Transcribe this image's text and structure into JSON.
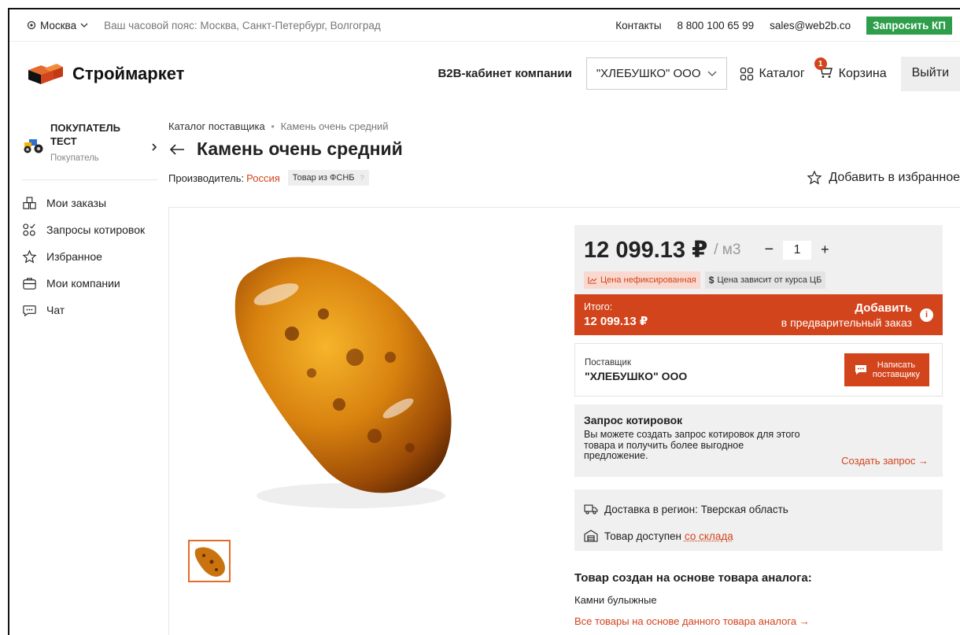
{
  "topbar": {
    "city": "Москва",
    "timezone": "Ваш часовой пояс: Москва, Санкт-Петербург, Волгоград",
    "contacts": "Контакты",
    "phone": "8 800 100 65 99",
    "email": "sales@web2b.co",
    "request_kp": "Запросить КП"
  },
  "header": {
    "logo": "Строймаркет",
    "b2b": "B2B-кабинет компании",
    "company": "\"ХЛЕБУШКО\" ООО",
    "catalog": "Каталог",
    "cart": "Корзина",
    "cart_count": "1",
    "logout": "Выйти"
  },
  "sidebar": {
    "user_name_1": "ПОКУПАТЕЛЬ",
    "user_name_2": "ТЕСТ",
    "user_role": "Покупатель",
    "items": [
      {
        "label": "Мои заказы",
        "icon": "orders-icon"
      },
      {
        "label": "Запросы котировок",
        "icon": "quotes-icon"
      },
      {
        "label": "Избранное",
        "icon": "star-icon"
      },
      {
        "label": "Мои компании",
        "icon": "briefcase-icon"
      },
      {
        "label": "Чат",
        "icon": "chat-icon"
      }
    ]
  },
  "breadcrumb": {
    "parent": "Каталог поставщика",
    "sep": "•",
    "current": "Камень очень средний"
  },
  "product": {
    "title": "Камень очень средний",
    "manufacturer_label": "Производитель:",
    "manufacturer": "Россия",
    "tag": "Товар из ФСНБ",
    "favorite": "Добавить в избранное",
    "price": "12 099.13 ₽",
    "unit": "/ м3",
    "quantity": "1",
    "chip_unfixed": "Цена нефиксированная",
    "chip_rate": "Цена зависит от курса ЦБ",
    "total_caption": "Итого:",
    "total": "12 099.13 ₽",
    "add_line1": "Добавить",
    "add_line2": "в предварительный заказ"
  },
  "supplier": {
    "caption": "Поставщик",
    "name": "\"ХЛЕБУШКО\" ООО",
    "write_line1": "Написать",
    "write_line2": "поставщику"
  },
  "quote": {
    "title": "Запрос котировок",
    "text": "Вы можете создать запрос котировок для этого товара и получить более выгодное предложение.",
    "link": "Создать запрос →"
  },
  "delivery": {
    "region": "Доставка в регион: Тверская область",
    "available_prefix": "Товар доступен",
    "available_link": "со склада"
  },
  "analog": {
    "title": "Товар создан на основе товара аналога:",
    "name": "Камни булыжные",
    "link": "Все товары на основе данного товара аналога →"
  },
  "colors": {
    "accent": "#d2441c",
    "green": "#2e9e4a"
  }
}
